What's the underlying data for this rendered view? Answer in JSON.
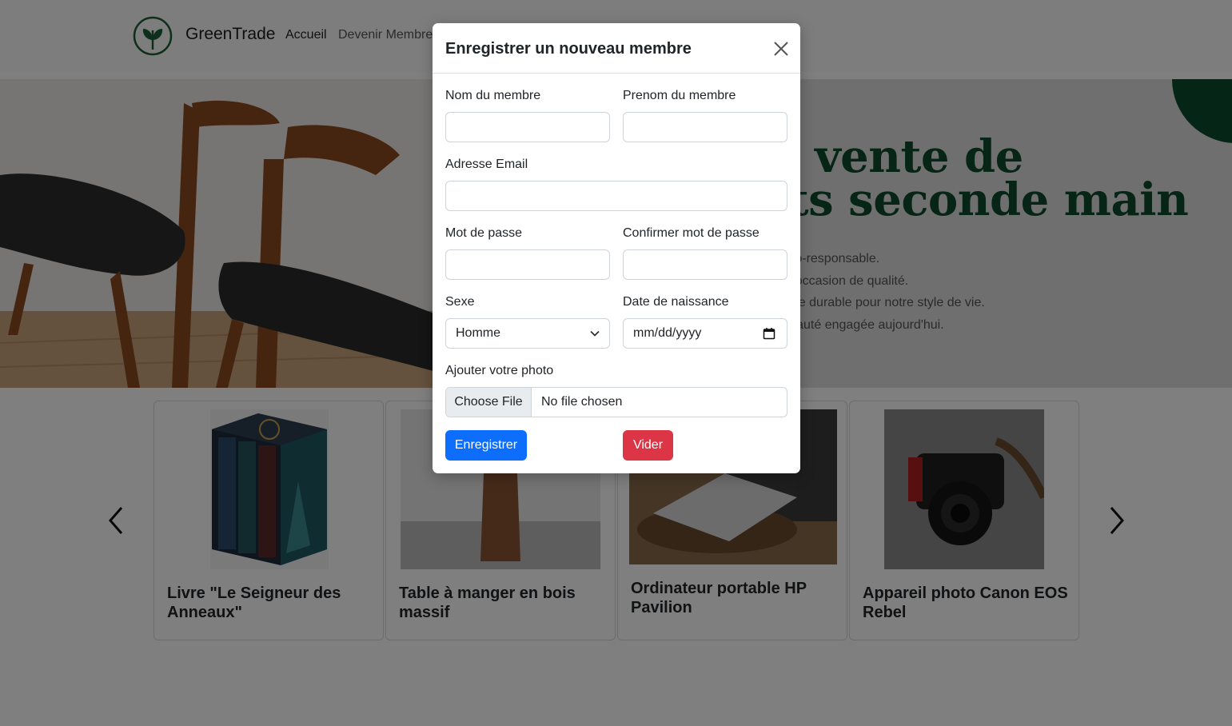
{
  "navbar": {
    "brand": "GreenTrade",
    "links": [
      "Accueil",
      "Devenir Membre"
    ]
  },
  "hero": {
    "title_line1": "e vente de",
    "title_line2": "its seconde main",
    "description": [
      "s éco-responsable.",
      "rs d'occasion de qualité.",
      "native durable pour notre style de vie.",
      "munauté engagée aujourd'hui."
    ]
  },
  "carousel": {
    "prev_icon": "chevron-left",
    "next_icon": "chevron-right",
    "cards": [
      {
        "title": "Livre \"Le Seigneur des Anneaux\""
      },
      {
        "title": "Table à manger en bois massif"
      },
      {
        "title": "Ordinateur portable HP Pavilion"
      },
      {
        "title": "Appareil photo Canon EOS Rebel"
      }
    ]
  },
  "modal": {
    "title": "Enregistrer un nouveau membre",
    "close_icon": "close-x",
    "fields": {
      "nom_label": "Nom du membre",
      "nom_value": "",
      "prenom_label": "Prenom du membre",
      "prenom_value": "",
      "email_label": "Adresse Email",
      "email_value": "",
      "password_label": "Mot de passe",
      "password_value": "",
      "confirm_label": "Confirmer mot de passe",
      "confirm_value": "",
      "sexe_label": "Sexe",
      "sexe_value": "Homme",
      "birth_label": "Date de naissance",
      "birth_placeholder": "mm/dd/yyyy",
      "photo_label": "Ajouter votre photo",
      "file_button": "Choose File",
      "file_status": "No file chosen"
    },
    "buttons": {
      "save": "Enregistrer",
      "clear": "Vider"
    }
  },
  "colors": {
    "brand_green": "#0e4a2d",
    "primary": "#0d6efd",
    "danger": "#dc3545",
    "backdrop": "rgba(0,0,0,0.5)"
  }
}
